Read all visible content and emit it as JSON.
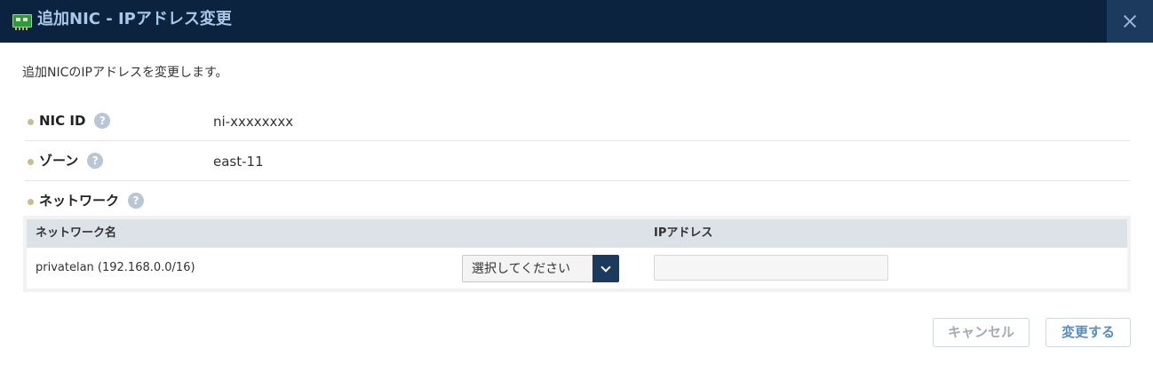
{
  "dialog": {
    "title": "追加NIC - IPアドレス変更",
    "description": "追加NICのIPアドレスを変更します。"
  },
  "fields": [
    {
      "label": "NIC ID",
      "value": "ni-xxxxxxxx"
    },
    {
      "label": "ゾーン",
      "value": "east-11"
    },
    {
      "label": "ネットワーク"
    }
  ],
  "help_glyph": "?",
  "network_table": {
    "headers": [
      "ネットワーク名",
      "IPアドレス"
    ],
    "rows": [
      {
        "network": "privatelan (192.168.0.0/16)",
        "select_value": "選択してください",
        "ip_value": ""
      }
    ]
  },
  "buttons": {
    "cancel": "キャンセル",
    "submit": "変更する"
  },
  "colors": {
    "header_bg": "#0c2340",
    "header_text": "#a9c7e8",
    "accent": "#1b3a5e",
    "bullet": "#c9bd8c",
    "help_icon": "#b9c6d6",
    "table_header": "#dde2e8",
    "submit_text": "#5a8dbd"
  },
  "icons": {
    "header": "nic-card-icon",
    "close": "close-icon",
    "help": "help-icon",
    "dropdown": "chevron-down-icon"
  }
}
